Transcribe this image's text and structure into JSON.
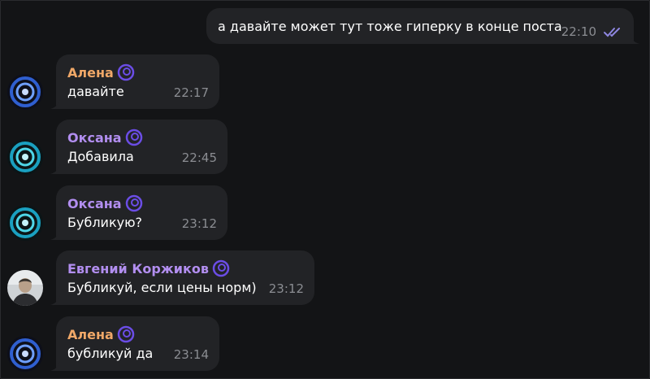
{
  "outgoing": {
    "text": "а давайте может тут тоже гиперку в конце поста",
    "time": "22:10",
    "status_icon": "double-check-icon"
  },
  "messages": [
    {
      "sender": "Алена",
      "sender_color": "#f0a868",
      "text": "давайте",
      "time": "22:17",
      "avatar": "spiral-avatar-blue"
    },
    {
      "sender": "Оксана",
      "sender_color": "#b28ef0",
      "text": "Добавила",
      "time": "22:45",
      "avatar": "spiral-avatar-cyan"
    },
    {
      "sender": "Оксана",
      "sender_color": "#b28ef0",
      "text": "Бубликую?",
      "time": "23:12",
      "avatar": "spiral-avatar-cyan"
    },
    {
      "sender": "Евгений Коржиков",
      "sender_color": "#b28ef0",
      "text": "Бубликуй, если цены норм)",
      "time": "23:12",
      "avatar": "photo-avatar"
    },
    {
      "sender": "Алена",
      "sender_color": "#f0a868",
      "text": "бубликуй да",
      "time": "23:14",
      "avatar": "spiral-avatar-blue"
    }
  ],
  "colors": {
    "background": "#131416",
    "bubble": "#222326",
    "badge": "#6b4de6",
    "time": "#8b8d92",
    "check": "#8e86e0"
  }
}
